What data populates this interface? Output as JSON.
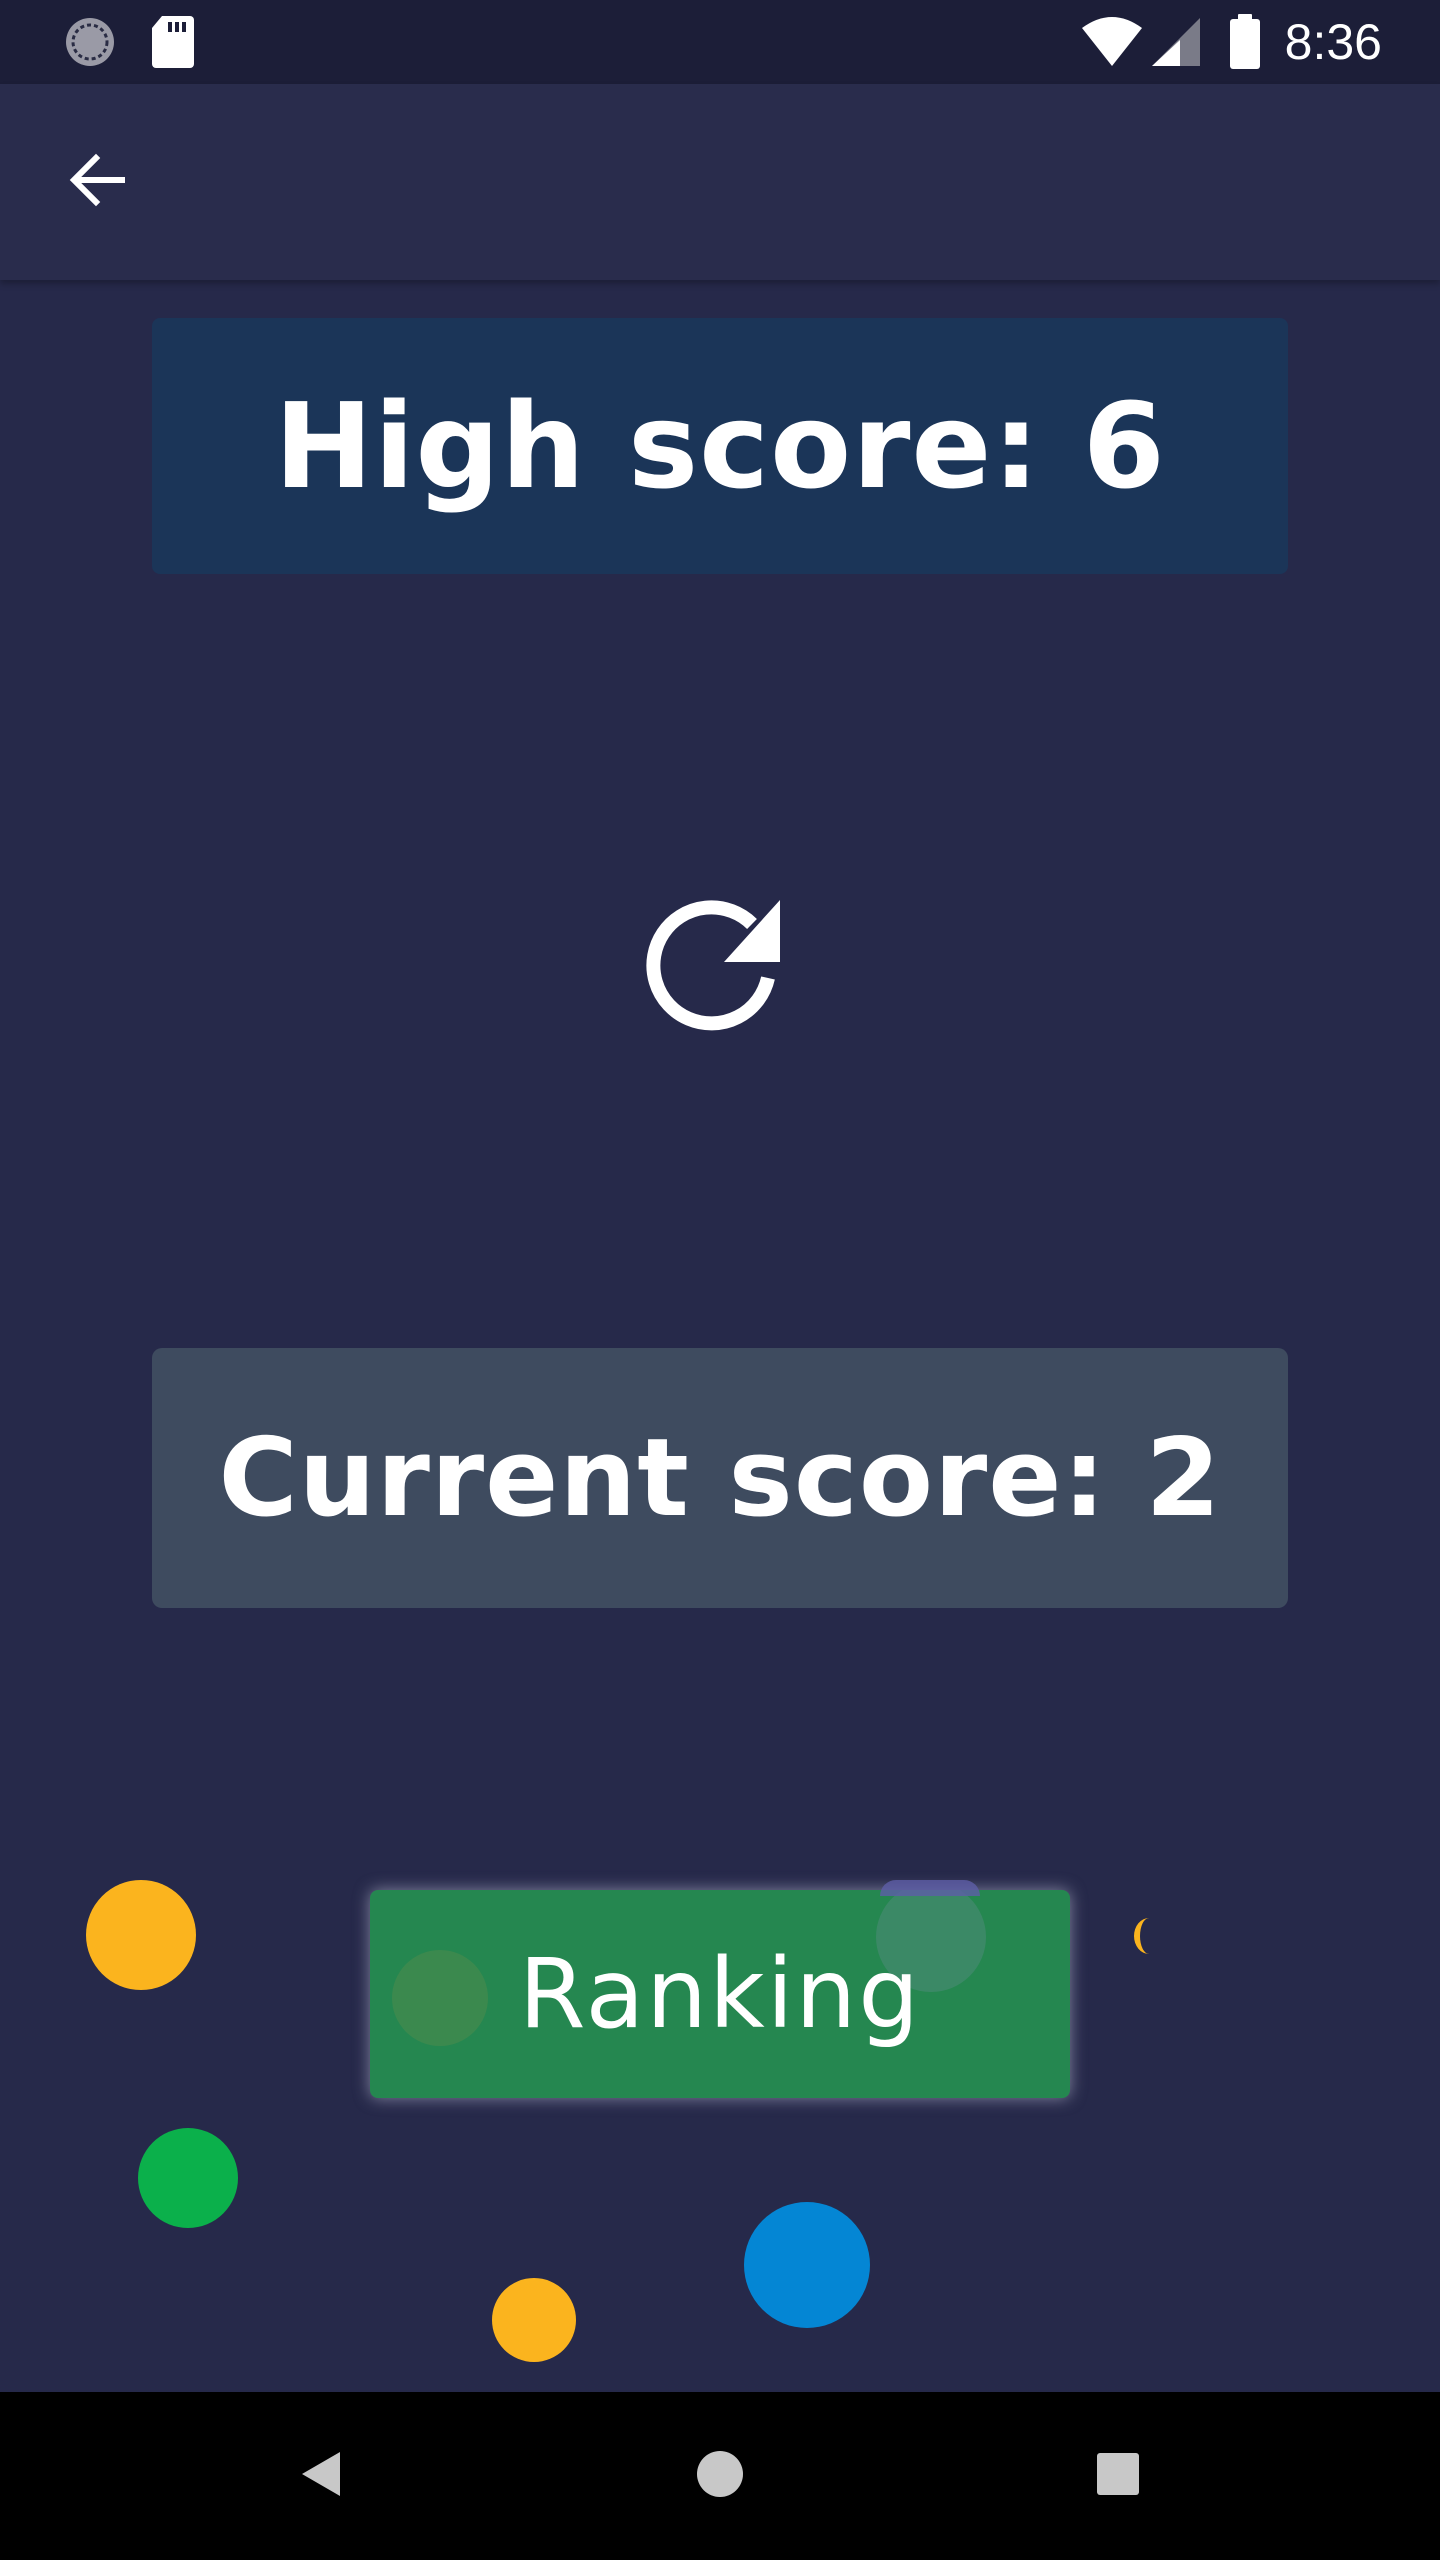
{
  "status_bar": {
    "time": "8:36",
    "icons": [
      "sync-icon",
      "sd-card-icon",
      "wifi-icon",
      "cellular-signal-icon",
      "battery-icon"
    ]
  },
  "app_bar": {
    "back_icon": "arrow-back-icon"
  },
  "high_score": {
    "label": "High score: 6",
    "bg_color": "#1b3558"
  },
  "restart": {
    "icon": "restart-icon"
  },
  "current_score": {
    "label": "Current score: 2",
    "bg_color": "#3e4b5f"
  },
  "ranking_button": {
    "label": "Ranking",
    "bg_color": "#258750"
  },
  "decor_colors": {
    "yellow": "#fbb41e",
    "green": "#0bb04b",
    "blue": "#0486d4",
    "purple": "#5e5ea8"
  },
  "nav_bar": {
    "icons": [
      "nav-back-icon",
      "nav-home-icon",
      "nav-recents-icon"
    ]
  }
}
